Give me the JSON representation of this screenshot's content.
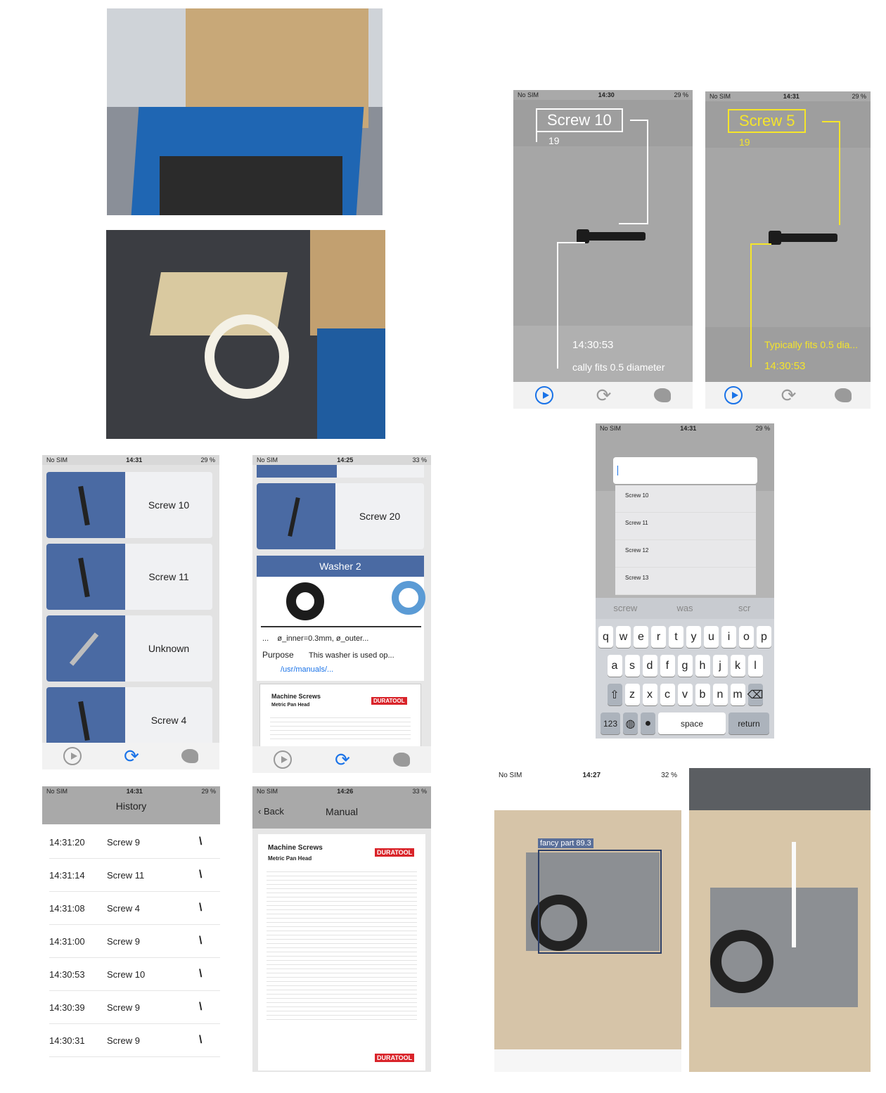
{
  "status": {
    "no_sim": "No SIM",
    "t1430": "14:30",
    "t1431": "14:31",
    "t1425": "14:25",
    "t1426": "14:26",
    "t1427": "14:27",
    "batt29": "29 %",
    "batt33": "33 %",
    "batt32": "32 %"
  },
  "ar1": {
    "label": "Screw 10",
    "count": "19",
    "time": "14:30:53",
    "desc": "cally fits 0.5 diameter"
  },
  "ar2": {
    "label": "Screw 5",
    "count": "19",
    "desc": "Typically fits 0.5 dia...",
    "time": "14:30:53"
  },
  "list": {
    "items": [
      "Screw 10",
      "Screw 11",
      "Unknown",
      "Screw 4"
    ]
  },
  "detail": {
    "item": "Screw 20",
    "washer_title": "Washer 2",
    "dims": "...    ø_inner=0.3mm, ø_outer...",
    "purpose_label": "Purpose",
    "purpose_value": "This washer is used op...",
    "link": "/usr/manuals/...",
    "doc_title": "Machine Screws",
    "doc_sub": "Metric Pan Head",
    "brand": "DURATOOL"
  },
  "history": {
    "title": "History",
    "rows": [
      {
        "time": "14:31:20",
        "name": "Screw 9"
      },
      {
        "time": "14:31:14",
        "name": "Screw 11"
      },
      {
        "time": "14:31:08",
        "name": "Screw 4"
      },
      {
        "time": "14:31:00",
        "name": "Screw 9"
      },
      {
        "time": "14:30:53",
        "name": "Screw 10"
      },
      {
        "time": "14:30:39",
        "name": "Screw 9"
      },
      {
        "time": "14:30:31",
        "name": "Screw 9"
      }
    ]
  },
  "manual": {
    "back": "Back",
    "title": "Manual",
    "doc_title": "Machine Screws",
    "doc_sub": "Metric Pan Head",
    "brand": "DURATOOL"
  },
  "search": {
    "suggestions": [
      "Screw 10",
      "Screw 11",
      "Screw 12",
      "Screw 13"
    ],
    "predictive": [
      "screw",
      "was",
      "scr"
    ],
    "row1": [
      "q",
      "w",
      "e",
      "r",
      "t",
      "y",
      "u",
      "i",
      "o",
      "p"
    ],
    "row2": [
      "a",
      "s",
      "d",
      "f",
      "g",
      "h",
      "j",
      "k",
      "l"
    ],
    "row3": [
      "z",
      "x",
      "c",
      "v",
      "b",
      "n",
      "m"
    ],
    "key_123": "123",
    "key_space": "space",
    "key_return": "return"
  },
  "detect": {
    "label": "fancy part 89.3"
  },
  "colors": {
    "accent": "#1a73e8",
    "card_blue": "#4a6aa3",
    "ar_yellow": "#f5e52a",
    "header_gray": "#a9a9a9"
  }
}
